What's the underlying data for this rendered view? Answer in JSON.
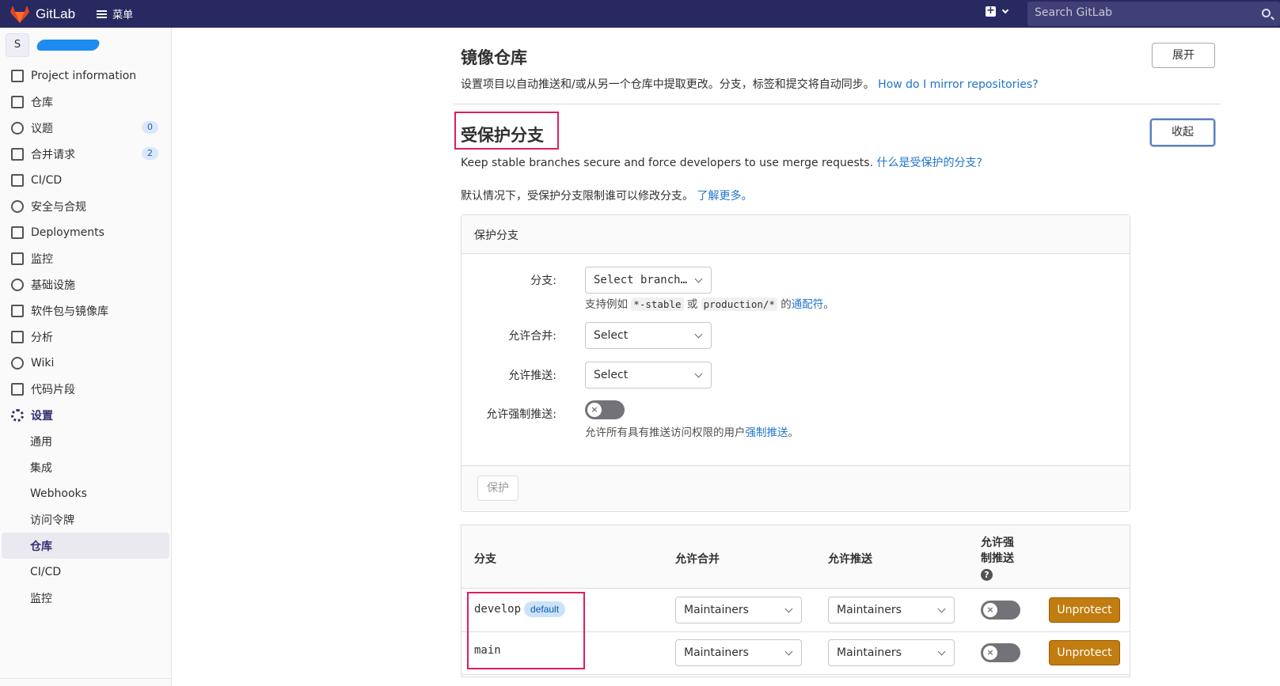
{
  "topbar": {
    "app_name": "GitLab",
    "menu_label": "菜单",
    "search_placeholder": "Search GitLab",
    "plus_symbol": "+"
  },
  "sidebar": {
    "project_initial": "S",
    "items": [
      {
        "label": "Project information",
        "icon": "info-icon"
      },
      {
        "label": "仓库",
        "icon": "repository-icon"
      },
      {
        "label": "议题",
        "icon": "issues-icon",
        "badge": "0"
      },
      {
        "label": "合并请求",
        "icon": "merge-request-icon",
        "badge": "2"
      },
      {
        "label": "CI/CD",
        "icon": "rocket-icon"
      },
      {
        "label": "安全与合规",
        "icon": "shield-icon"
      },
      {
        "label": "Deployments",
        "icon": "deployments-icon"
      },
      {
        "label": "监控",
        "icon": "monitor-icon"
      },
      {
        "label": "基础设施",
        "icon": "cloud-icon"
      },
      {
        "label": "软件包与镜像库",
        "icon": "package-icon"
      },
      {
        "label": "分析",
        "icon": "chart-icon"
      },
      {
        "label": "Wiki",
        "icon": "book-icon"
      },
      {
        "label": "代码片段",
        "icon": "scissors-icon"
      },
      {
        "label": "设置",
        "icon": "gear-icon"
      }
    ],
    "sub_items": [
      "通用",
      "集成",
      "Webhooks",
      "访问令牌",
      "仓库",
      "CI/CD",
      "监控"
    ]
  },
  "mirror": {
    "title": "镜像仓库",
    "description": "设置项目以自动推送和/或从另一个仓库中提取更改。分支，标签和提交将自动同步。",
    "link": "How do I mirror repositories?",
    "expand_button": "展开"
  },
  "protected": {
    "title": "受保护分支",
    "description": "Keep stable branches secure and force developers to use merge requests.",
    "link": "什么是受保护的分支?",
    "collapse_button": "收起",
    "default_note": "默认情况下，受保护分支限制谁可以修改分支。",
    "learn_more": "了解更多。"
  },
  "form": {
    "card_title": "保护分支",
    "branch_label": "分支:",
    "branch_placeholder": "Select branch…",
    "branch_help_prefix": "支持例如",
    "branch_help_code1": "*-stable",
    "branch_help_or": "或",
    "branch_help_code2": "production/*",
    "branch_help_mid": "的",
    "branch_help_link": "通配符",
    "branch_help_end": "。",
    "merge_label": "允许合并:",
    "merge_value": "Select",
    "push_label": "允许推送:",
    "push_value": "Select",
    "force_label": "允许强制推送:",
    "force_help_prefix": "允许所有具有推送访问权限的用户",
    "force_help_link": "强制推送",
    "force_help_end": "。",
    "protect_button": "保护"
  },
  "table": {
    "headers": {
      "branch": "分支",
      "merge": "允许合并",
      "push": "允许推送",
      "force_line1": "允许强",
      "force_line2": "制推送",
      "help": "?"
    },
    "rows": [
      {
        "branch": "develop",
        "tag": "default",
        "merge": "Maintainers",
        "push": "Maintainers",
        "action": "Unprotect"
      },
      {
        "branch": "main",
        "tag": "",
        "merge": "Maintainers",
        "push": "Maintainers",
        "action": "Unprotect"
      }
    ]
  },
  "toggle_off_symbol": "×"
}
